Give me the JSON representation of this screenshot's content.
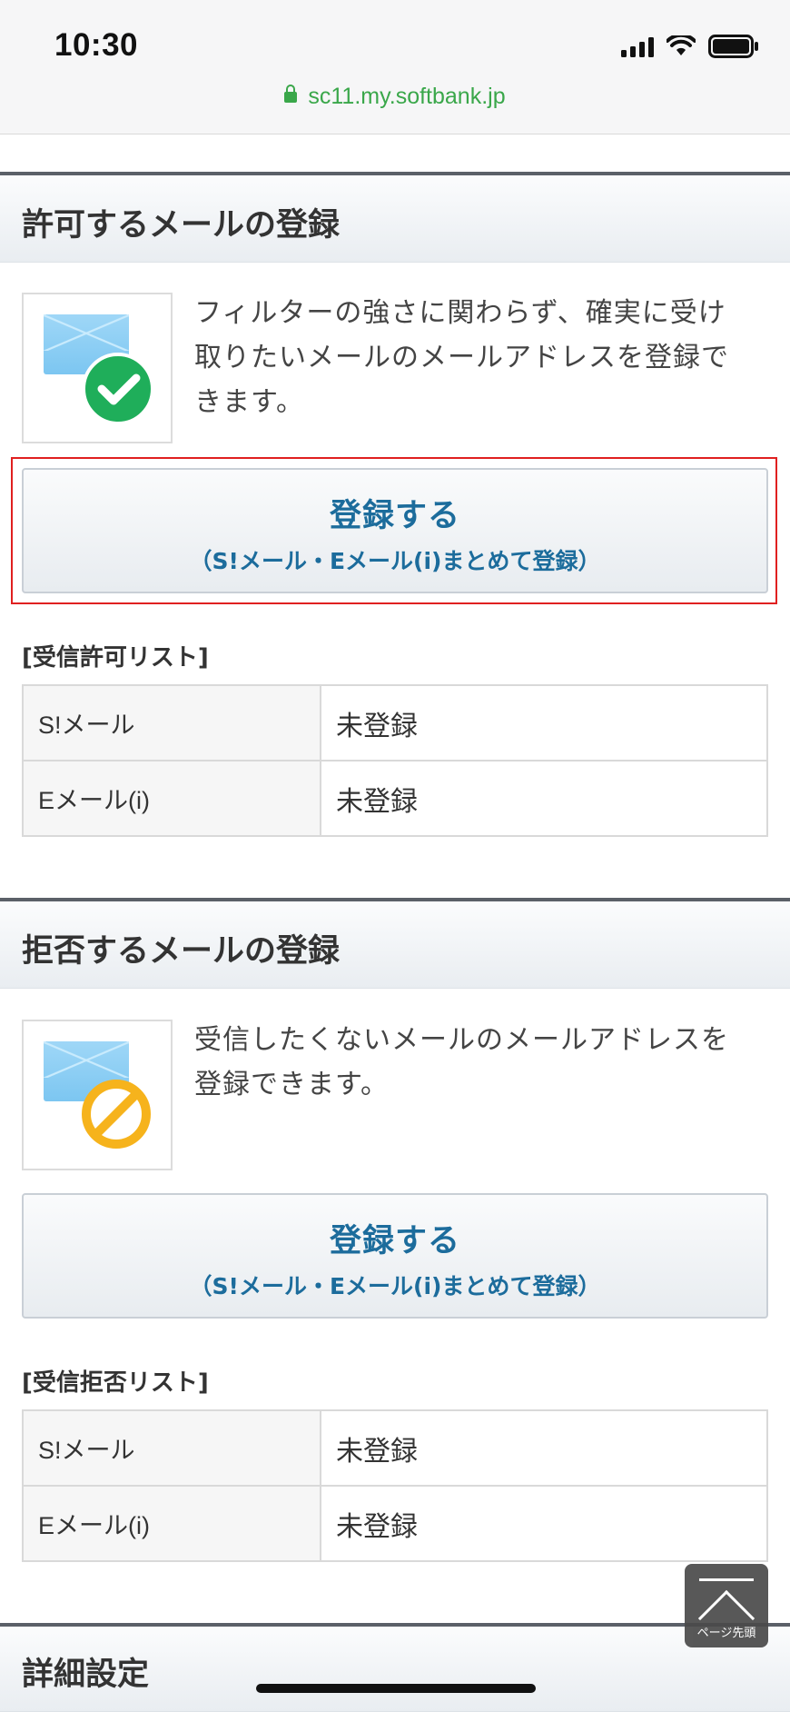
{
  "status_bar": {
    "time": "10:30"
  },
  "browser": {
    "url": "sc11.my.softbank.jp"
  },
  "allow_section": {
    "title": "許可するメールの登録",
    "description_lines": [
      "フィルターの強さに関わらず、確実に受け",
      "取りたいメールのメールアドレスを登録で",
      "きます。"
    ],
    "button_main": "登録する",
    "button_sub": "（S!メール・Eメール(i)まとめて登録）",
    "list_label": "[受信許可リスト]",
    "rows": [
      {
        "key": "S!メール",
        "value": "未登録"
      },
      {
        "key": "Eメール(i)",
        "value": "未登録"
      }
    ]
  },
  "deny_section": {
    "title": "拒否するメールの登録",
    "description_lines": [
      "受信したくないメールのメールアドレスを",
      "登録できます。"
    ],
    "button_main": "登録する",
    "button_sub": "（S!メール・Eメール(i)まとめて登録）",
    "list_label": "[受信拒否リスト]",
    "rows": [
      {
        "key": "S!メール",
        "value": "未登録"
      },
      {
        "key": "Eメール(i)",
        "value": "未登録"
      }
    ]
  },
  "details_section": {
    "title": "詳細設定"
  },
  "page_top": {
    "label": "ページ先頭"
  },
  "colors": {
    "accent": "#1c6c9c",
    "highlight": "#e02020",
    "check": "#1fae5a",
    "prohibit": "#f6b31c",
    "url": "#3aa74a"
  },
  "icons": [
    "lock-icon",
    "signal-icon",
    "wifi-icon",
    "battery-icon",
    "mail-allow-icon",
    "mail-deny-icon",
    "page-top-icon"
  ]
}
